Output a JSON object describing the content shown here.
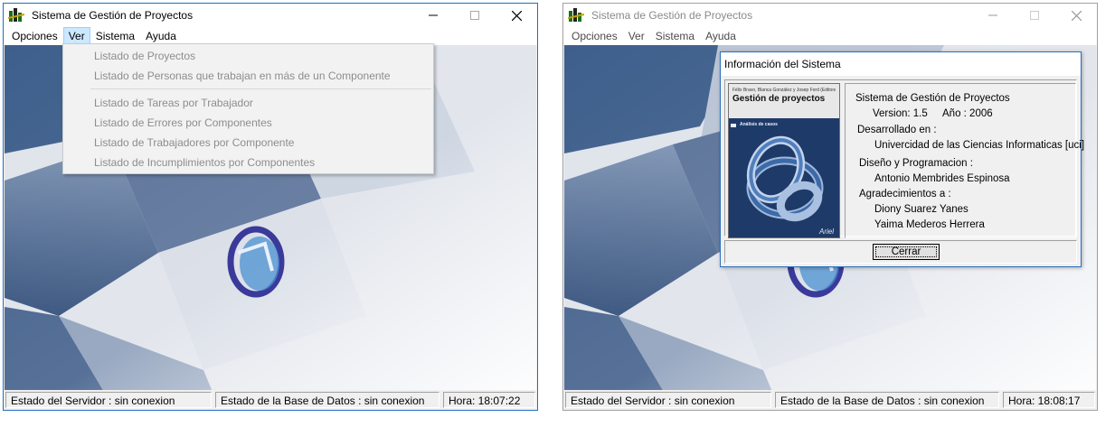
{
  "window_left": {
    "title": "Sistema de Gestión de Proyectos",
    "menu": [
      "Opciones",
      "Ver",
      "Sistema",
      "Ayuda"
    ],
    "active_menu": "Ver",
    "dropdown": {
      "group1": [
        "Listado de Proyectos",
        "Listado de Personas que trabajan en más de un Componente"
      ],
      "group2": [
        "Listado de Tareas por Trabajador",
        "Listado de Errores por Componentes",
        "Listado de  Trabajadores  por Componente",
        "Listado de Incumplimientos por Componentes"
      ]
    },
    "status": {
      "server": "Estado del Servidor :  sin conexion",
      "database": "Estado de la Base de Datos : sin conexion",
      "time": "Hora: 18:07:22"
    }
  },
  "window_right": {
    "title": "Sistema de Gestión de Proyectos",
    "menu": [
      "Opciones",
      "Ver",
      "Sistema",
      "Ayuda"
    ],
    "status": {
      "server": "Estado del Servidor :  sin conexion",
      "database": "Estado de la Base de Datos : sin conexion",
      "time": "Hora: 18:08:17"
    }
  },
  "dialog": {
    "title": "Información del Sistema",
    "book": {
      "authors": "Félix Bravo, Blanca González y Josep Ford (Editores)",
      "title": "Gestión de proyectos",
      "subtitle": "Análisis de casos",
      "publisher": "Ariel"
    },
    "info": {
      "app_name": "Sistema de Gestión de Proyectos",
      "version_label": "Version: 1.5",
      "year_label": "Año :   2006",
      "developed_label": "Desarrollado en :",
      "developed_value": "Univercidad de las Ciencias Informaticas [uci]",
      "design_label": "Diseño y Programacion :",
      "design_value": "Antonio Membrides Espinosa",
      "thanks_label": "Agradecimientos a :",
      "thanks_1": "Diony Suarez Yanes",
      "thanks_2": "Yaima Mederos Herrera"
    },
    "close_button": "Cerrar"
  },
  "colors": {
    "menu_highlight": "#cce8ff",
    "disabled_text": "#8d8d8d",
    "active_border": "#1f6fc4",
    "keyboard_key": "#3e5f8c"
  },
  "icons": {
    "app_icon": "app-logo-icon",
    "minimize": "minimize-icon",
    "maximize": "maximize-icon",
    "close": "close-icon",
    "background_logo": "circular-arrows-logo"
  }
}
